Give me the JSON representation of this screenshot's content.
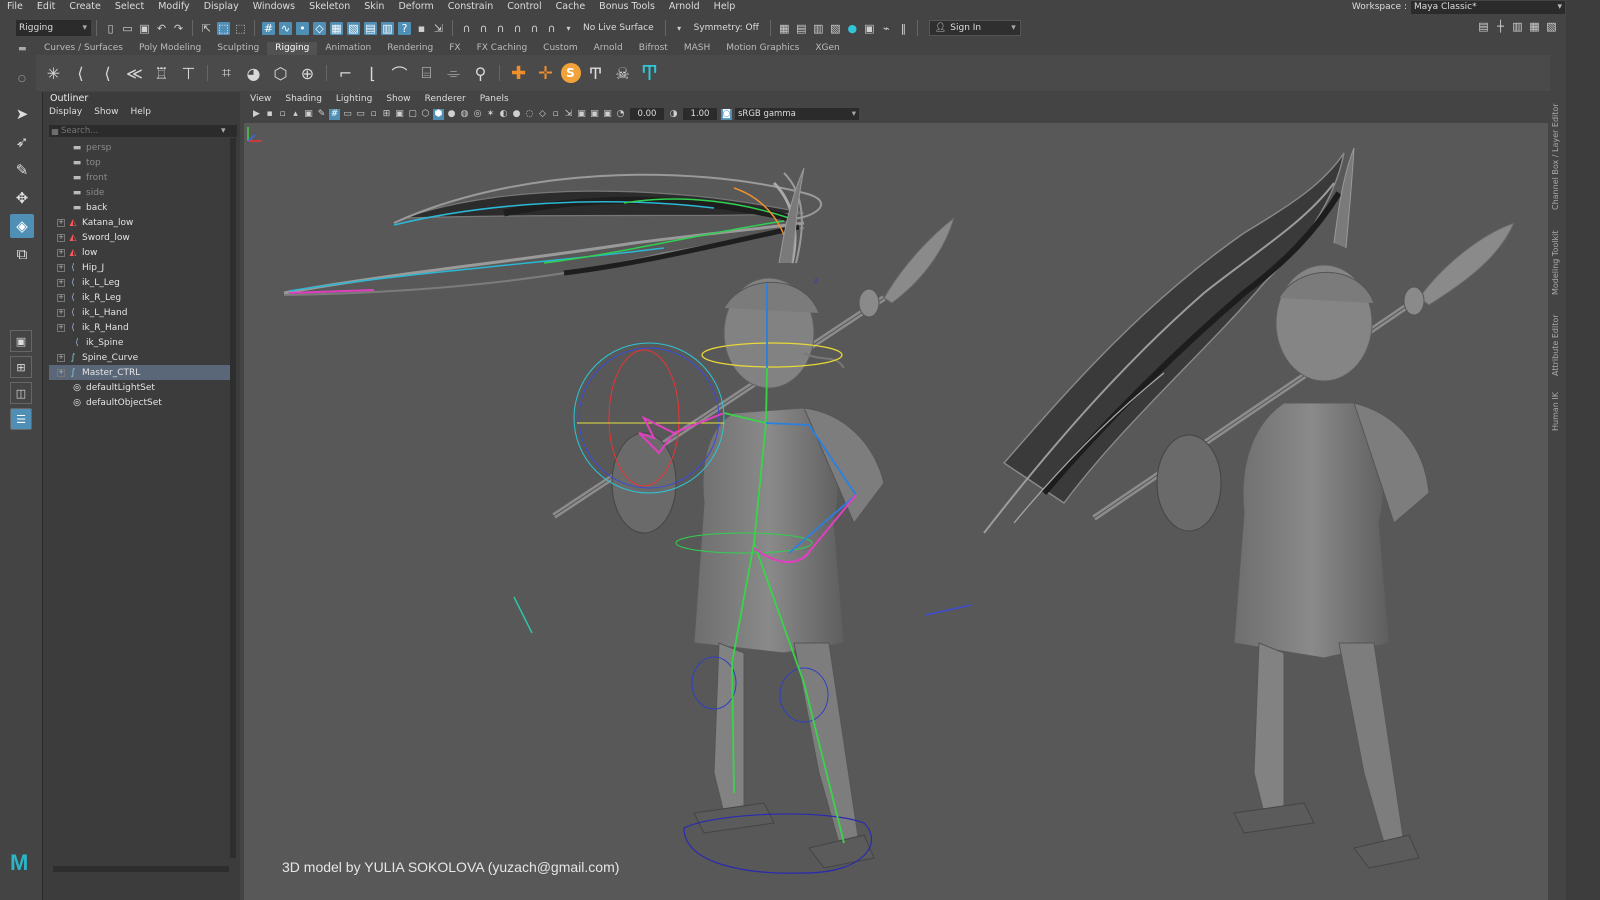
{
  "menubar": {
    "items": [
      "File",
      "Edit",
      "Create",
      "Select",
      "Modify",
      "Display",
      "Windows",
      "Skeleton",
      "Skin",
      "Deform",
      "Constrain",
      "Control",
      "Cache",
      "Bonus Tools",
      "Arnold",
      "Help"
    ],
    "workspace_label": "Workspace :",
    "workspace_value": "Maya Classic*"
  },
  "statusline": {
    "menuset": "Rigging",
    "live_surface": "No Live Surface",
    "symmetry": "Symmetry: Off",
    "sign_in": "Sign In"
  },
  "shelf": {
    "tabs": [
      "Curves / Surfaces",
      "Poly Modeling",
      "Sculpting",
      "Rigging",
      "Animation",
      "Rendering",
      "FX",
      "FX Caching",
      "Custom",
      "Arnold",
      "Bifrost",
      "MASH",
      "Motion Graphics",
      "XGen"
    ],
    "active_tab": "Rigging"
  },
  "outliner": {
    "title": "Outliner",
    "menu": [
      "Display",
      "Show",
      "Help"
    ],
    "search_placeholder": "Search...",
    "items": [
      {
        "name": "persp",
        "type": "camera",
        "expandable": false,
        "dim": true
      },
      {
        "name": "top",
        "type": "camera",
        "expandable": false,
        "dim": true
      },
      {
        "name": "front",
        "type": "camera",
        "expandable": false,
        "dim": true
      },
      {
        "name": "side",
        "type": "camera",
        "expandable": false,
        "dim": true
      },
      {
        "name": "back",
        "type": "camera",
        "expandable": false,
        "dim": false
      },
      {
        "name": "Katana_low",
        "type": "mesh",
        "expandable": true,
        "dim": false
      },
      {
        "name": "Sword_low",
        "type": "mesh",
        "expandable": true,
        "dim": false
      },
      {
        "name": "low",
        "type": "mesh",
        "expandable": true,
        "dim": false
      },
      {
        "name": "Hip_J",
        "type": "joint",
        "expandable": true,
        "dim": false
      },
      {
        "name": "ik_L_Leg",
        "type": "ik",
        "expandable": true,
        "dim": false
      },
      {
        "name": "ik_R_Leg",
        "type": "ik",
        "expandable": true,
        "dim": false
      },
      {
        "name": "ik_L_Hand",
        "type": "ik",
        "expandable": true,
        "dim": false
      },
      {
        "name": "ik_R_Hand",
        "type": "ik",
        "expandable": true,
        "dim": false
      },
      {
        "name": "ik_Spine",
        "type": "ik",
        "expandable": false,
        "dim": false
      },
      {
        "name": "Spine_Curve",
        "type": "curve",
        "expandable": true,
        "dim": false
      },
      {
        "name": "Master_CTRL",
        "type": "curve",
        "expandable": true,
        "dim": false,
        "selected": true
      },
      {
        "name": "defaultLightSet",
        "type": "set",
        "expandable": false,
        "dim": false
      },
      {
        "name": "defaultObjectSet",
        "type": "set",
        "expandable": false,
        "dim": false
      }
    ]
  },
  "viewport": {
    "menu": [
      "View",
      "Shading",
      "Lighting",
      "Show",
      "Renderer",
      "Panels"
    ],
    "exposure": "0.00",
    "gamma": "1.00",
    "color_space": "sRGB gamma",
    "credit_prefix": "3D model by ",
    "credit_name": "YULIA SOKOLOVA",
    "credit_email": "(yuzach@gmail.com)"
  },
  "right_tabs": [
    "Channel Box / Layer Editor",
    "Modeling Toolkit",
    "Attribute Editor",
    "Human IK"
  ],
  "colors": {
    "accent": "#4f8fb6",
    "viewport_bg": "#585858",
    "selection": "#5a6778",
    "maya_logo": "#2bb5c7"
  }
}
